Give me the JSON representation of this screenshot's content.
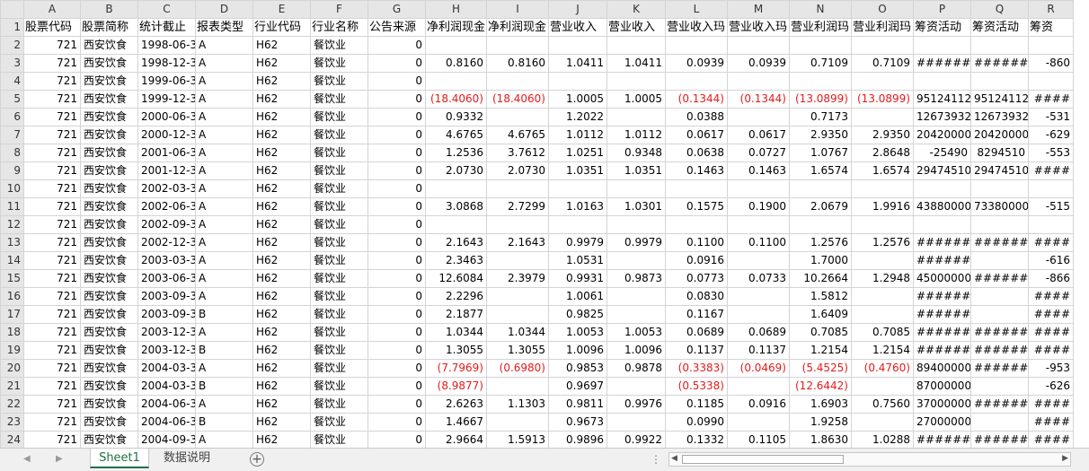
{
  "columns": [
    "A",
    "B",
    "C",
    "D",
    "E",
    "F",
    "G",
    "H",
    "I",
    "J",
    "K",
    "L",
    "M",
    "N",
    "O",
    "P",
    "Q",
    "R"
  ],
  "header_row": [
    "股票代码",
    "股票简称",
    "统计截止",
    "报表类型",
    "行业代码",
    "行业名称",
    "公告来源",
    "净利润现金",
    "净利润现金",
    "营业收入",
    "营业收入",
    "营业收入玛",
    "营业收入玛",
    "营业利润玛",
    "营业利润玛",
    "筹资活动",
    "筹资活动",
    "筹资"
  ],
  "rows": [
    [
      "721",
      "西安饮食",
      "1998-06-3",
      "A",
      "H62",
      "餐饮业",
      "0",
      "",
      "",
      "",
      "",
      "",
      "",
      "",
      "",
      "",
      "",
      ""
    ],
    [
      "721",
      "西安饮食",
      "1998-12-3",
      "A",
      "H62",
      "餐饮业",
      "0",
      "0.8160",
      "0.8160",
      "1.0411",
      "1.0411",
      "0.0939",
      "0.0939",
      "0.7109",
      "0.7109",
      "########",
      "########",
      "-860"
    ],
    [
      "721",
      "西安饮食",
      "1999-06-3",
      "A",
      "H62",
      "餐饮业",
      "0",
      "",
      "",
      "",
      "",
      "",
      "",
      "",
      "",
      "",
      "",
      ""
    ],
    [
      "721",
      "西安饮食",
      "1999-12-3",
      "A",
      "H62",
      "餐饮业",
      "0",
      "(18.4060)",
      "(18.4060)",
      "1.0005",
      "1.0005",
      "(0.1344)",
      "(0.1344)",
      "(13.0899)",
      "(13.0899)",
      "95124112",
      "95124112",
      "####"
    ],
    [
      "721",
      "西安饮食",
      "2000-06-3",
      "A",
      "H62",
      "餐饮业",
      "0",
      "0.9332",
      "",
      "1.2022",
      "",
      "0.0388",
      "",
      "0.7173",
      "",
      "12673932",
      "12673932",
      "-531"
    ],
    [
      "721",
      "西安饮食",
      "2000-12-3",
      "A",
      "H62",
      "餐饮业",
      "0",
      "4.6765",
      "4.6765",
      "1.0112",
      "1.0112",
      "0.0617",
      "0.0617",
      "2.9350",
      "2.9350",
      "20420000",
      "20420000",
      "-629"
    ],
    [
      "721",
      "西安饮食",
      "2001-06-3",
      "A",
      "H62",
      "餐饮业",
      "0",
      "1.2536",
      "3.7612",
      "1.0251",
      "0.9348",
      "0.0638",
      "0.0727",
      "1.0767",
      "2.8648",
      "-25490",
      "8294510",
      "-553"
    ],
    [
      "721",
      "西安饮食",
      "2001-12-3",
      "A",
      "H62",
      "餐饮业",
      "0",
      "2.0730",
      "2.0730",
      "1.0351",
      "1.0351",
      "0.1463",
      "0.1463",
      "1.6574",
      "1.6574",
      "29474510",
      "29474510",
      "####"
    ],
    [
      "721",
      "西安饮食",
      "2002-03-3",
      "A",
      "H62",
      "餐饮业",
      "0",
      "",
      "",
      "",
      "",
      "",
      "",
      "",
      "",
      "",
      "",
      ""
    ],
    [
      "721",
      "西安饮食",
      "2002-06-3",
      "A",
      "H62",
      "餐饮业",
      "0",
      "3.0868",
      "2.7299",
      "1.0163",
      "1.0301",
      "0.1575",
      "0.1900",
      "2.0679",
      "1.9916",
      "43880000",
      "73380000",
      "-515"
    ],
    [
      "721",
      "西安饮食",
      "2002-09-3",
      "A",
      "H62",
      "餐饮业",
      "0",
      "",
      "",
      "",
      "",
      "",
      "",
      "",
      "",
      "",
      "",
      ""
    ],
    [
      "721",
      "西安饮食",
      "2002-12-3",
      "A",
      "H62",
      "餐饮业",
      "0",
      "2.1643",
      "2.1643",
      "0.9979",
      "0.9979",
      "0.1100",
      "0.1100",
      "1.2576",
      "1.2576",
      "########",
      "########",
      "####"
    ],
    [
      "721",
      "西安饮食",
      "2003-03-3",
      "A",
      "H62",
      "餐饮业",
      "0",
      "2.3463",
      "",
      "1.0531",
      "",
      "0.0916",
      "",
      "1.7000",
      "",
      "########",
      "",
      "-616"
    ],
    [
      "721",
      "西安饮食",
      "2003-06-3",
      "A",
      "H62",
      "餐饮业",
      "0",
      "12.6084",
      "2.3979",
      "0.9931",
      "0.9873",
      "0.0773",
      "0.0733",
      "10.2664",
      "1.2948",
      "45000000",
      "########",
      "-866"
    ],
    [
      "721",
      "西安饮食",
      "2003-09-3",
      "A",
      "H62",
      "餐饮业",
      "0",
      "2.2296",
      "",
      "1.0061",
      "",
      "0.0830",
      "",
      "1.5812",
      "",
      "########",
      "",
      "####"
    ],
    [
      "721",
      "西安饮食",
      "2003-09-3",
      "B",
      "H62",
      "餐饮业",
      "0",
      "2.1877",
      "",
      "0.9825",
      "",
      "0.1167",
      "",
      "1.6409",
      "",
      "########",
      "",
      "####"
    ],
    [
      "721",
      "西安饮食",
      "2003-12-3",
      "A",
      "H62",
      "餐饮业",
      "0",
      "1.0344",
      "1.0344",
      "1.0053",
      "1.0053",
      "0.0689",
      "0.0689",
      "0.7085",
      "0.7085",
      "########",
      "########",
      "####"
    ],
    [
      "721",
      "西安饮食",
      "2003-12-3",
      "B",
      "H62",
      "餐饮业",
      "0",
      "1.3055",
      "1.3055",
      "1.0096",
      "1.0096",
      "0.1137",
      "0.1137",
      "1.2154",
      "1.2154",
      "########",
      "########",
      "####"
    ],
    [
      "721",
      "西安饮食",
      "2004-03-3",
      "A",
      "H62",
      "餐饮业",
      "0",
      "(7.7969)",
      "(0.6980)",
      "0.9853",
      "0.9878",
      "(0.3383)",
      "(0.0469)",
      "(5.4525)",
      "(0.4760)",
      "89400000",
      "########",
      "-953"
    ],
    [
      "721",
      "西安饮食",
      "2004-03-3",
      "B",
      "H62",
      "餐饮业",
      "0",
      "(8.9877)",
      "",
      "0.9697",
      "",
      "(0.5338)",
      "",
      "(12.6442)",
      "",
      "87000000",
      "",
      "-626"
    ],
    [
      "721",
      "西安饮食",
      "2004-06-3",
      "A",
      "H62",
      "餐饮业",
      "0",
      "2.6263",
      "1.1303",
      "0.9811",
      "0.9976",
      "0.1185",
      "0.0916",
      "1.6903",
      "0.7560",
      "37000000",
      "########",
      "####"
    ],
    [
      "721",
      "西安饮食",
      "2004-06-3",
      "B",
      "H62",
      "餐饮业",
      "0",
      "1.4667",
      "",
      "0.9673",
      "",
      "0.0990",
      "",
      "1.9258",
      "",
      "27000000",
      "",
      "####"
    ],
    [
      "721",
      "西安饮食",
      "2004-09-3",
      "A",
      "H62",
      "餐饮业",
      "0",
      "2.9664",
      "1.5913",
      "0.9896",
      "0.9922",
      "0.1332",
      "0.1105",
      "1.8630",
      "1.0288",
      "########",
      "########",
      "####"
    ]
  ],
  "sheet_tabs": [
    {
      "label": "Sheet1",
      "active": true
    },
    {
      "label": "数据说明",
      "active": false
    }
  ],
  "nav_left_arrow": "◀",
  "nav_right_arrow": "▶",
  "add_sheet_symbol": "+",
  "split_dots": "⋮",
  "scroll_left_arrow": "◀",
  "scroll_right_arrow": "▶",
  "colors": {
    "negative": "#e31b1b",
    "active_tab": "#1e7145",
    "header_bg": "#e6e6e6",
    "grid_line": "#d4d4d4"
  }
}
